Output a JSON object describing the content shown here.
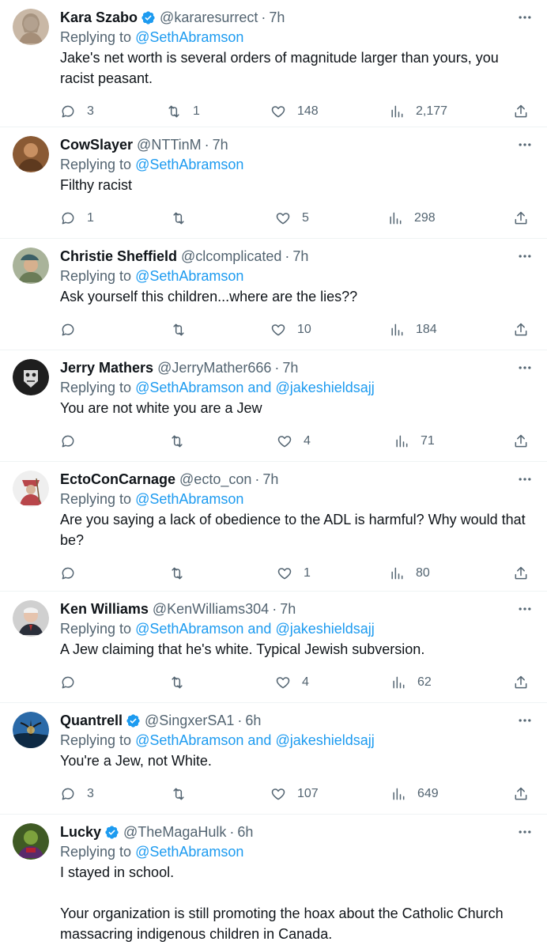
{
  "replies": [
    {
      "name": "Kara Szabo",
      "verified": true,
      "handle": "@kararesurrect",
      "time": "7h",
      "replying_prefix": "Replying to ",
      "replying_to": "@SethAbramson",
      "text": "Jake's net worth is several orders of magnitude larger than yours, you racist peasant.",
      "replies_count": "3",
      "retweets": "1",
      "likes": "148",
      "views": "2,177",
      "avatar_color": "#c9b8a6"
    },
    {
      "name": "CowSlayer",
      "verified": false,
      "handle": "@NTTinM",
      "time": "7h",
      "replying_prefix": "Replying to ",
      "replying_to": "@SethAbramson",
      "text": "Filthy racist",
      "replies_count": "1",
      "retweets": "",
      "likes": "5",
      "views": "298",
      "avatar_color": "#8a5a34"
    },
    {
      "name": "Christie Sheffield",
      "verified": false,
      "handle": "@clcomplicated",
      "time": "7h",
      "replying_prefix": "Replying to ",
      "replying_to": "@SethAbramson",
      "text": "Ask yourself this children...where are the lies??",
      "replies_count": "",
      "retweets": "",
      "likes": "10",
      "views": "184",
      "avatar_color": "#7d8a6c"
    },
    {
      "name": "Jerry Mathers",
      "verified": false,
      "handle": "@JerryMather666",
      "time": "7h",
      "replying_prefix": "Replying to ",
      "replying_to": "@SethAbramson and @jakeshieldsajj",
      "text": "You are not white you are a Jew",
      "replies_count": "",
      "retweets": "",
      "likes": "4",
      "views": "71",
      "avatar_color": "#2b2b2b"
    },
    {
      "name": "EctoConCarnage",
      "verified": false,
      "handle": "@ecto_con",
      "time": "7h",
      "replying_prefix": "Replying to ",
      "replying_to": "@SethAbramson",
      "text": "Are you saying a lack of obedience to the ADL is harmful? Why would that be?",
      "replies_count": "",
      "retweets": "",
      "likes": "1",
      "views": "80",
      "avatar_color": "#b8464a"
    },
    {
      "name": "Ken Williams",
      "verified": false,
      "handle": "@KenWilliams304",
      "time": "7h",
      "replying_prefix": "Replying to ",
      "replying_to": "@SethAbramson and @jakeshieldsajj",
      "text": "A Jew claiming that he's white. Typical Jewish subversion.",
      "replies_count": "",
      "retweets": "",
      "likes": "4",
      "views": "62",
      "avatar_color": "#6e6e6e"
    },
    {
      "name": "Quantrell",
      "verified": true,
      "handle": "@SingxerSA1",
      "time": "6h",
      "replying_prefix": "Replying to ",
      "replying_to": "@SethAbramson and @jakeshieldsajj",
      "text": "You're a Jew, not White.",
      "replies_count": "3",
      "retweets": "",
      "likes": "107",
      "views": "649",
      "avatar_color": "#1f4d7a"
    },
    {
      "name": "Lucky",
      "verified": true,
      "handle": "@TheMagaHulk",
      "time": "6h",
      "replying_prefix": "Replying to ",
      "replying_to": "@SethAbramson",
      "text": "I stayed in school.\n\nYour organization is still promoting the hoax about the Catholic Church massacring indigenous children in Canada.",
      "replies_count": "",
      "retweets": "",
      "likes": "",
      "views": "",
      "avatar_color": "#4f6b2e"
    }
  ],
  "colors": {
    "link": "#1d9bf0",
    "muted": "#536471",
    "text": "#0f1419",
    "verified": "#1d9bf0"
  },
  "icons": [
    "reply-icon",
    "retweet-icon",
    "like-icon",
    "views-icon",
    "share-icon",
    "more-icon",
    "verified-icon"
  ]
}
